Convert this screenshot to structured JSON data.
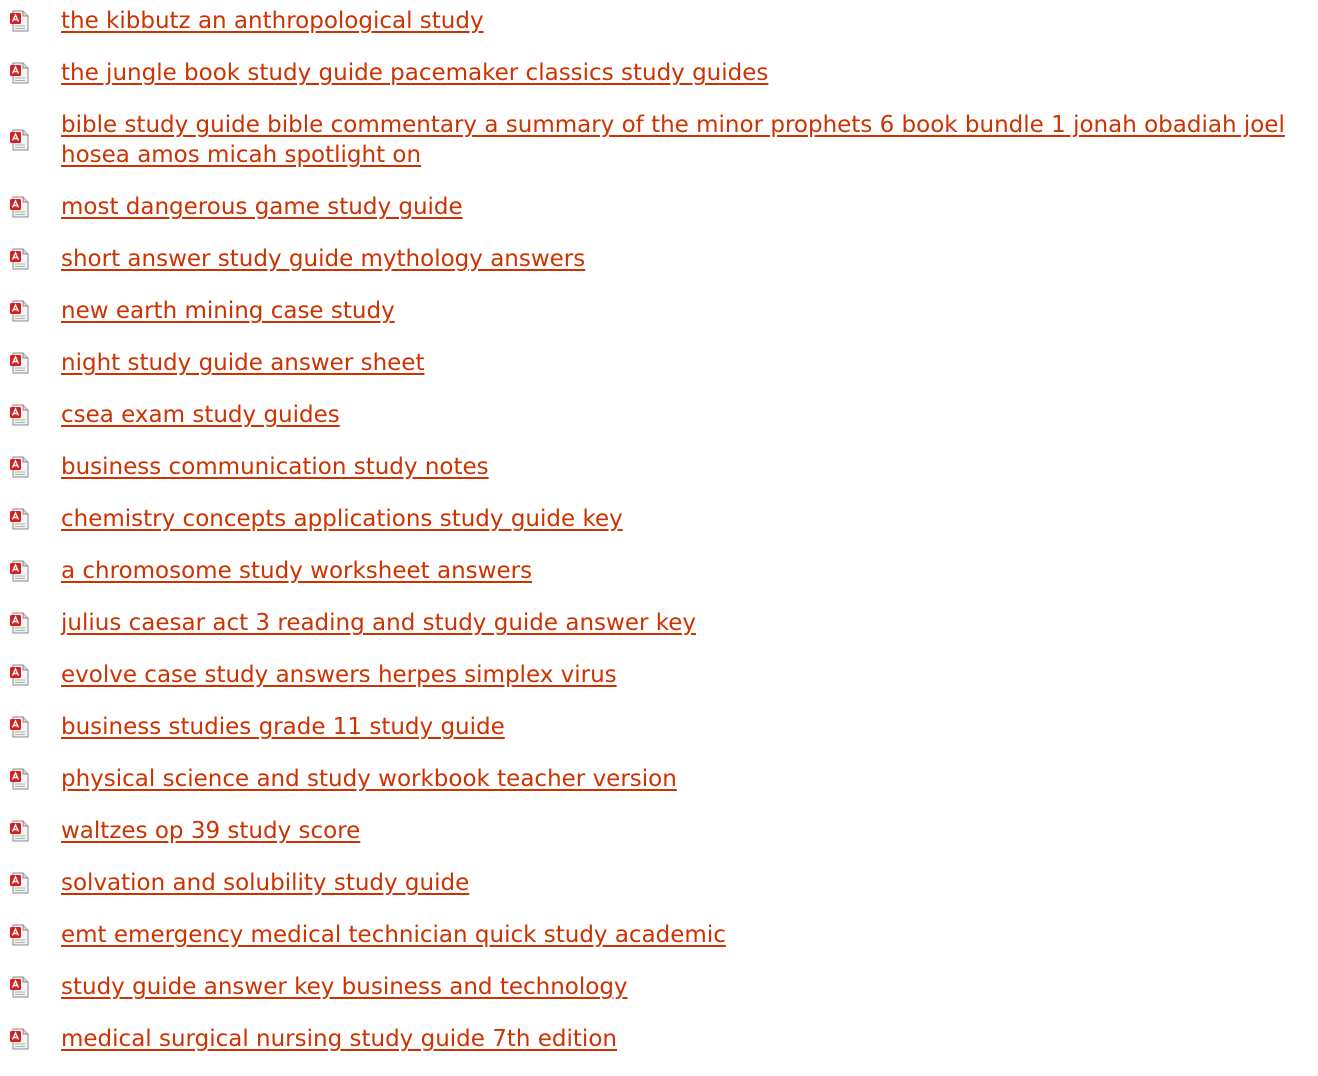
{
  "links": [
    {
      "label": "the kibbutz an anthropological study",
      "icon": "pdf-file-icon"
    },
    {
      "label": "the jungle book study guide pacemaker classics study guides",
      "icon": "pdf-file-icon"
    },
    {
      "label": "bible study guide bible commentary a summary of the minor prophets 6 book bundle 1 jonah obadiah joel hosea amos micah spotlight on",
      "icon": "pdf-file-icon"
    },
    {
      "label": "most dangerous game study guide",
      "icon": "pdf-file-icon"
    },
    {
      "label": "short answer study guide mythology answers",
      "icon": "pdf-file-icon"
    },
    {
      "label": "new earth mining case study",
      "icon": "pdf-file-icon"
    },
    {
      "label": "night study guide answer sheet",
      "icon": "pdf-file-icon"
    },
    {
      "label": "csea exam study guides",
      "icon": "pdf-file-icon"
    },
    {
      "label": "business communication study notes",
      "icon": "pdf-file-icon"
    },
    {
      "label": "chemistry concepts applications study guide key",
      "icon": "pdf-file-icon"
    },
    {
      "label": "a chromosome study worksheet answers",
      "icon": "pdf-file-icon"
    },
    {
      "label": "julius caesar act 3 reading and study guide answer key",
      "icon": "pdf-file-icon"
    },
    {
      "label": "evolve case study answers herpes simplex virus",
      "icon": "pdf-file-icon"
    },
    {
      "label": "business studies grade 11 study guide",
      "icon": "pdf-file-icon"
    },
    {
      "label": "physical science and study workbook teacher version",
      "icon": "pdf-file-icon"
    },
    {
      "label": "waltzes op 39 study score",
      "icon": "pdf-file-icon"
    },
    {
      "label": "solvation and solubility study guide",
      "icon": "pdf-file-icon"
    },
    {
      "label": "emt emergency medical technician quick study academic",
      "icon": "pdf-file-icon"
    },
    {
      "label": "study guide answer key business and technology",
      "icon": "pdf-file-icon"
    },
    {
      "label": "medical surgical nursing study guide 7th edition",
      "icon": "pdf-file-icon"
    }
  ],
  "colors": {
    "link": "#cc3300",
    "pdf_red": "#d42020",
    "page_gray": "#d8d8d8"
  }
}
